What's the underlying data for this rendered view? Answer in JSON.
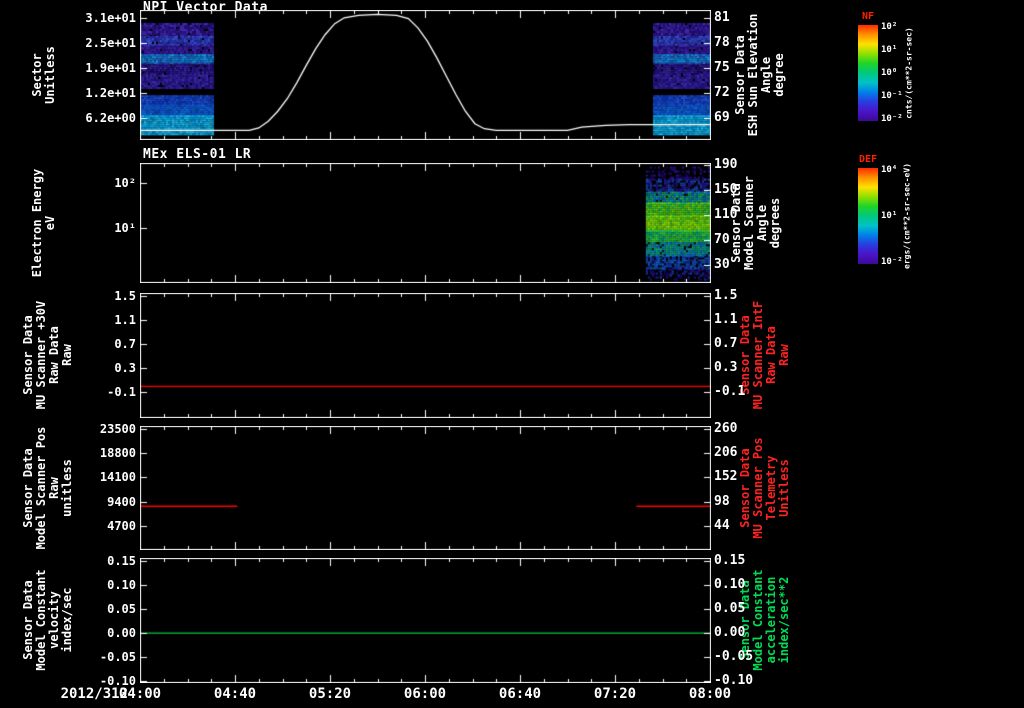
{
  "page": {
    "background": "#000000",
    "text_color": "#ffffff",
    "accent_red": "#ff2222",
    "accent_green": "#00dd55"
  },
  "x_axis": {
    "date_label": "2012/312",
    "tick_labels": [
      "04:00",
      "04:40",
      "05:20",
      "06:00",
      "06:40",
      "07:20",
      "08:00"
    ],
    "t_start_min": 0,
    "t_end_min": 240,
    "major_tick_min": 40,
    "minor_tick_min": 10
  },
  "colorbars": [
    {
      "name": "NF",
      "name_color": "#ff2200",
      "tick_labels": [
        "10²",
        "10¹",
        "10⁰",
        "10⁻¹",
        "10⁻²"
      ],
      "tick_fracs": [
        0.02,
        0.26,
        0.5,
        0.74,
        0.98
      ],
      "units": "cnts/(cm**2-sr-sec)",
      "gradient": [
        "#ff2a00",
        "#ff9100",
        "#ffe000",
        "#8fe000",
        "#1fd428",
        "#00c87e",
        "#00c2c8",
        "#0080e8",
        "#2a3ce0",
        "#4a14c8",
        "#3c0a96"
      ]
    },
    {
      "name": "DEF",
      "name_color": "#ff2200",
      "tick_labels": [
        "10⁴",
        "10¹",
        "10⁻²"
      ],
      "tick_fracs": [
        0.02,
        0.5,
        0.98
      ],
      "units": "ergs/(cm**2-sr-sec-eV)",
      "gradient": [
        "#ff2a00",
        "#ff9100",
        "#ffe000",
        "#8fe000",
        "#1fd428",
        "#00c87e",
        "#00c2c8",
        "#0080e8",
        "#2a3ce0",
        "#4a14c8",
        "#3c0a96"
      ]
    }
  ],
  "chart_data": [
    {
      "type": "heatmap",
      "subtype": "spectrogram+line",
      "title": "NPI Vector Data",
      "left_label": "Sector\nUnitless",
      "left_ticks": [
        {
          "label": "3.1e+01",
          "frac": 0.06
        },
        {
          "label": "2.5e+01",
          "frac": 0.2525
        },
        {
          "label": "1.9e+01",
          "frac": 0.445
        },
        {
          "label": "1.2e+01",
          "frac": 0.6375
        },
        {
          "label": "6.2e+00",
          "frac": 0.83
        }
      ],
      "right_ticks": [
        {
          "label": "81",
          "frac": 0.06
        },
        {
          "label": "78",
          "frac": 0.2525
        },
        {
          "label": "75",
          "frac": 0.445
        },
        {
          "label": "72",
          "frac": 0.6375
        },
        {
          "label": "69",
          "frac": 0.83
        }
      ],
      "right_label": "Sensor Data\nESH Sun Elevation\nAngle\ndegree",
      "right_label_color": "#ffffff",
      "series": [
        {
          "name": "esh_sun_elevation_angle_deg",
          "color": "#ffffff",
          "axis": "right",
          "x_min": [
            0,
            46,
            50,
            54,
            58,
            62,
            66,
            70,
            74,
            78,
            82,
            86,
            92,
            100,
            108,
            113,
            117,
            121,
            125,
            129,
            133,
            137,
            141,
            145,
            150,
            180,
            186,
            196,
            206,
            240
          ],
          "y": [
            67.5,
            67.5,
            67.8,
            68.6,
            69.8,
            71.3,
            73.2,
            75.3,
            77.3,
            79.0,
            80.3,
            81.0,
            81.3,
            81.4,
            81.3,
            80.9,
            79.8,
            78.2,
            76.2,
            74.0,
            71.8,
            69.8,
            68.3,
            67.7,
            67.5,
            67.5,
            67.9,
            68.1,
            68.2,
            68.2
          ],
          "y_to_frac": {
            "v1": 81,
            "f1": 0.06,
            "v2": 69,
            "f2": 0.83
          }
        }
      ],
      "rowsets": {
        "npi": [
          {
            "f0": 0.1,
            "f1": 0.2,
            "colors": [
              "#33189e",
              "#2a1284",
              "#452cb4",
              "#200d72"
            ],
            "density": 0.95
          },
          {
            "f0": 0.2,
            "f1": 0.27,
            "colors": [
              "#2a3cc0",
              "#3350d0",
              "#2a28a0"
            ],
            "density": 0.95
          },
          {
            "f0": 0.27,
            "f1": 0.34,
            "colors": [
              "#31189b",
              "#3f24ac",
              "#241080"
            ],
            "density": 0.95
          },
          {
            "f0": 0.34,
            "f1": 0.41,
            "colors": [
              "#0d86d8",
              "#1898e2",
              "#0b6cbe",
              "#2a5ad0"
            ],
            "density": 1
          },
          {
            "f0": 0.41,
            "f1": 0.5,
            "colors": [
              "#2a1698",
              "#3a26a4",
              "#1f0d74"
            ],
            "density": 0.95
          },
          {
            "f0": 0.5,
            "f1": 0.6,
            "colors": [
              "#2d1a96",
              "#221282",
              "#3c28aa"
            ],
            "density": 0.95
          },
          {
            "f0": 0.655,
            "f1": 0.73,
            "colors": [
              "#1244cc",
              "#0d38bc",
              "#2052da"
            ],
            "density": 1
          },
          {
            "f0": 0.73,
            "f1": 0.81,
            "colors": [
              "#0d66d8",
              "#1258d0",
              "#0d4ac8"
            ],
            "density": 1
          },
          {
            "f0": 0.81,
            "f1": 0.962,
            "colors": [
              "#00a8e8",
              "#14b6ee",
              "#0694da",
              "#24c6f4"
            ],
            "density": 1
          }
        ]
      },
      "spectrogram_patches": [
        {
          "t0": 0,
          "t1": 31,
          "rowset": "npi"
        },
        {
          "t0": 216,
          "t1": 240,
          "rowset": "npi"
        }
      ]
    },
    {
      "type": "heatmap",
      "subtype": "spectrogram",
      "title": "MEx ELS-01 LR",
      "left_label": "Electron Energy\neV",
      "left_ticks": [
        {
          "label": "10²",
          "frac": 0.17
        },
        {
          "label": "10¹",
          "frac": 0.545
        }
      ],
      "right_ticks": [
        {
          "label": "190",
          "frac": 0.017
        },
        {
          "label": "150",
          "frac": 0.225
        },
        {
          "label": "110",
          "frac": 0.433
        },
        {
          "label": "70",
          "frac": 0.642
        },
        {
          "label": "30",
          "frac": 0.85
        }
      ],
      "right_label": "Sensor Data\nModel Scanner\nAngle\ndegrees",
      "right_label_color": "#ffffff",
      "rowsets": {
        "els": [
          {
            "f0": 0.03,
            "f1": 0.13,
            "colors": [
              "#1c0a6e",
              "#2a0e8c",
              "#150754",
              "#3313a0"
            ],
            "density": 0.4
          },
          {
            "f0": 0.13,
            "f1": 0.24,
            "colors": [
              "#2a1090",
              "#1f3fae",
              "#0d55b8",
              "#22128c"
            ],
            "density": 0.65
          },
          {
            "f0": 0.24,
            "f1": 0.33,
            "colors": [
              "#0d7ec2",
              "#0f9e7a",
              "#1cb058",
              "#0d66b8"
            ],
            "density": 0.95
          },
          {
            "f0": 0.33,
            "f1": 0.44,
            "colors": [
              "#3acc1e",
              "#5cd816",
              "#1ec24a",
              "#7adc10"
            ],
            "density": 1
          },
          {
            "f0": 0.44,
            "f1": 0.56,
            "colors": [
              "#86e20a",
              "#9ce800",
              "#62d812",
              "#4ad022"
            ],
            "density": 1
          },
          {
            "f0": 0.56,
            "f1": 0.66,
            "colors": [
              "#2cc43a",
              "#12b262",
              "#48cc24",
              "#0fae80"
            ],
            "density": 1
          },
          {
            "f0": 0.66,
            "f1": 0.77,
            "colors": [
              "#0d9e92",
              "#0d84b4",
              "#10a670",
              "#0d74c0"
            ],
            "density": 0.92
          },
          {
            "f0": 0.77,
            "f1": 0.88,
            "colors": [
              "#0d54c6",
              "#1a46be",
              "#0d68d2",
              "#182aa8"
            ],
            "density": 0.75
          },
          {
            "f0": 0.88,
            "f1": 0.97,
            "colors": [
              "#1e0a80",
              "#2c1296",
              "#0d3fae",
              "#150760"
            ],
            "density": 0.5
          }
        ]
      },
      "spectrogram_patches": [
        {
          "t0": 213,
          "t1": 240,
          "rowset": "els"
        }
      ]
    },
    {
      "type": "line",
      "title": "",
      "left_label": "Sensor Data\nMU Scanner +30V\nRaw Data\nRaw",
      "left_ticks": [
        {
          "label": "1.5",
          "frac": 0.025
        },
        {
          "label": "1.1",
          "frac": 0.2175
        },
        {
          "label": "0.7",
          "frac": 0.41
        },
        {
          "label": "0.3",
          "frac": 0.6025
        },
        {
          "label": "-0.1",
          "frac": 0.795
        }
      ],
      "right_ticks": [
        {
          "label": "1.5",
          "frac": 0.025
        },
        {
          "label": "1.1",
          "frac": 0.2175
        },
        {
          "label": "0.7",
          "frac": 0.41
        },
        {
          "label": "0.3",
          "frac": 0.6025
        },
        {
          "label": "-0.1",
          "frac": 0.795
        }
      ],
      "right_label": "Sensor Data\nMU Scanner IntF\nRaw Data\nRaw",
      "right_label_color": "#ff2222",
      "series": [
        {
          "name": "mu_scanner_intf_raw",
          "color": "#ff0000",
          "axis": "left",
          "x_min": [
            0,
            240
          ],
          "y": [
            0.0,
            0.0
          ],
          "y_to_frac": {
            "v1": 1.5,
            "f1": 0.025,
            "v2": -0.1,
            "f2": 0.795
          }
        }
      ]
    },
    {
      "type": "line",
      "title": "",
      "left_label": "Sensor Data\nModel Scanner Pos\nRaw\nunitless",
      "left_ticks": [
        {
          "label": "23500",
          "frac": 0.025
        },
        {
          "label": "18800",
          "frac": 0.22
        },
        {
          "label": "14100",
          "frac": 0.415
        },
        {
          "label": "9400",
          "frac": 0.61
        },
        {
          "label": "4700",
          "frac": 0.805
        }
      ],
      "right_ticks": [
        {
          "label": "260",
          "frac": 0.025
        },
        {
          "label": "206",
          "frac": 0.22
        },
        {
          "label": "152",
          "frac": 0.415
        },
        {
          "label": "98",
          "frac": 0.61
        },
        {
          "label": "44",
          "frac": 0.805
        }
      ],
      "right_label": "Sensor Data\nMU Scanner Pos\nTelemetry\nUnitless",
      "right_label_color": "#ff2222",
      "series": [
        {
          "name": "model_scanner_pos_seg1",
          "color": "#ff0000",
          "axis": "left",
          "x_min": [
            0,
            41
          ],
          "y": [
            8500,
            8500
          ],
          "y_to_frac": {
            "v1": 23500,
            "f1": 0.025,
            "v2": 4700,
            "f2": 0.805
          }
        },
        {
          "name": "model_scanner_pos_seg2",
          "color": "#ff0000",
          "axis": "left",
          "x_min": [
            209,
            240
          ],
          "y": [
            8500,
            8500
          ],
          "y_to_frac": {
            "v1": 23500,
            "f1": 0.025,
            "v2": 4700,
            "f2": 0.805
          }
        }
      ]
    },
    {
      "type": "line",
      "title": "",
      "left_label": "Sensor Data\nModel Constant\nvelocity\nindex/sec",
      "left_ticks": [
        {
          "label": "0.15",
          "frac": 0.025
        },
        {
          "label": "0.10",
          "frac": 0.217
        },
        {
          "label": "0.05",
          "frac": 0.409
        },
        {
          "label": "0.00",
          "frac": 0.601
        },
        {
          "label": "-0.05",
          "frac": 0.793
        },
        {
          "label": "-0.10",
          "frac": 0.985
        }
      ],
      "right_ticks": [
        {
          "label": "0.15",
          "frac": 0.025
        },
        {
          "label": "0.10",
          "frac": 0.217
        },
        {
          "label": "0.05",
          "frac": 0.409
        },
        {
          "label": "0.00",
          "frac": 0.601
        },
        {
          "label": "-0.05",
          "frac": 0.793
        },
        {
          "label": "-0.10",
          "frac": 0.985
        }
      ],
      "right_label": "Sensor Data\nModel Constant\nacceleration\nindex/sec**2",
      "right_label_color": "#00dd55",
      "series": [
        {
          "name": "model_constant_acceleration",
          "color": "#00cc44",
          "axis": "left",
          "x_min": [
            0,
            240
          ],
          "y": [
            0.0,
            0.0
          ],
          "y_to_frac": {
            "v1": 0.15,
            "f1": 0.025,
            "v2": -0.1,
            "f2": 0.985
          }
        }
      ]
    }
  ]
}
